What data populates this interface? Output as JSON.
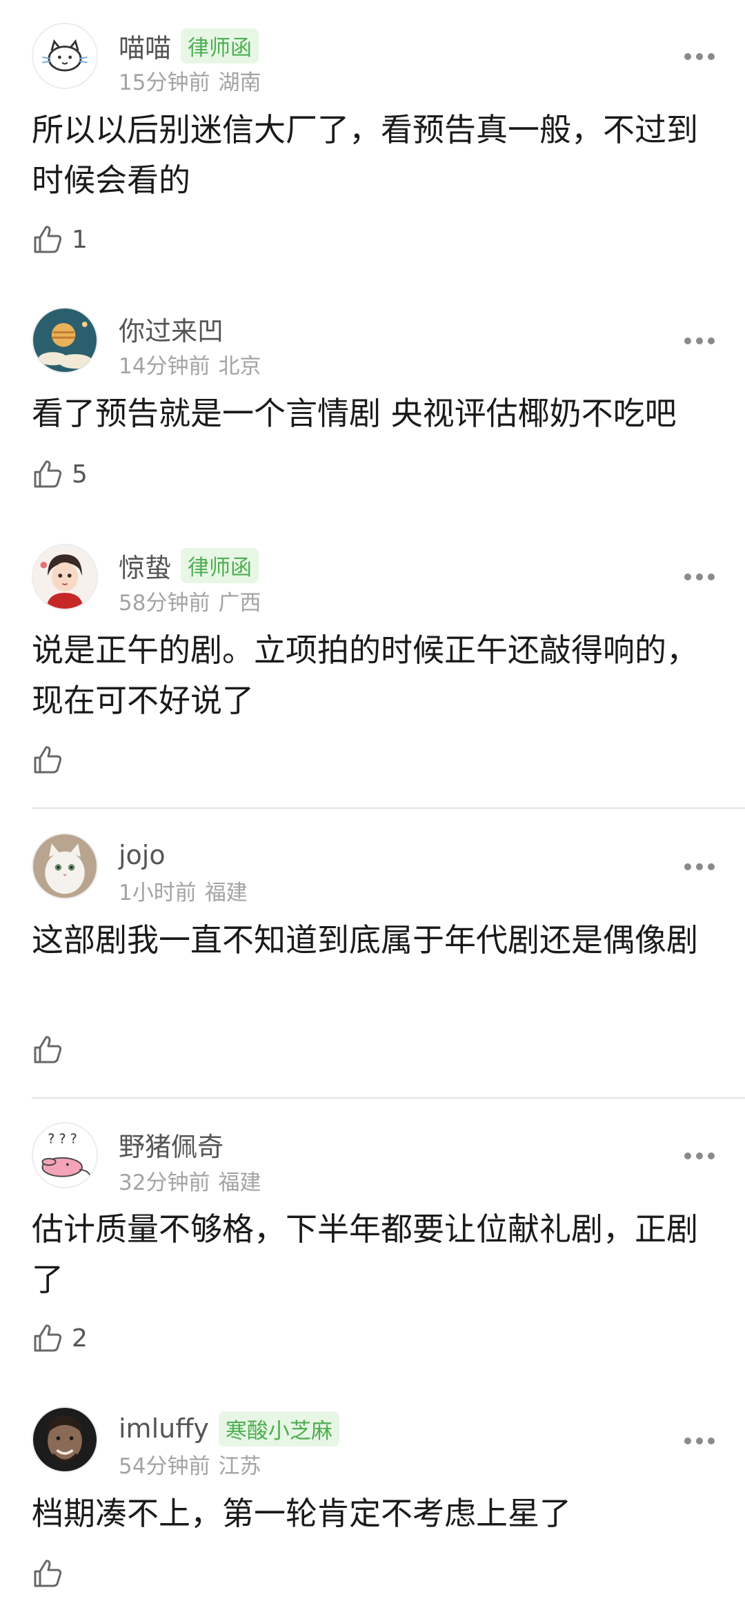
{
  "comments": [
    {
      "username": "喵喵",
      "badge": "律师函",
      "time": "15分钟前",
      "region": "湖南",
      "text": "所以以后别迷信大厂了，看预告真一般，不过到时候会看的",
      "likes": "1",
      "avatar_icon": "cat-doodle-avatar"
    },
    {
      "username": "你过来凹",
      "badge": "",
      "time": "14分钟前",
      "region": "北京",
      "text": "看了预告就是一个言情剧 央视评估椰奶不吃吧",
      "likes": "5",
      "avatar_icon": "planet-avatar"
    },
    {
      "username": "惊蛰",
      "badge": "律师函",
      "time": "58分钟前",
      "region": "广西",
      "text": "说是正午的剧。立项拍的时候正午还敲得响的，现在可不好说了",
      "likes": "",
      "avatar_icon": "cartoon-boy-avatar"
    },
    {
      "username": "jojo",
      "badge": "",
      "time": "1小时前",
      "region": "福建",
      "text": "这部剧我一直不知道到底属于年代剧还是偶像剧",
      "likes": "",
      "avatar_icon": "white-cat-avatar"
    },
    {
      "username": "野猪佩奇",
      "badge": "",
      "time": "32分钟前",
      "region": "福建",
      "text": "估计质量不够格，下半年都要让位献礼剧，正剧了",
      "likes": "2",
      "avatar_icon": "pink-rabbit-avatar"
    },
    {
      "username": "imluffy",
      "badge": "寒酸小芝麻",
      "time": "54分钟前",
      "region": "江苏",
      "text": "档期凑不上，第一轮肯定不考虑上星了",
      "likes": "",
      "avatar_icon": "man-portrait-avatar"
    }
  ],
  "colors": {
    "username": "#555555",
    "meta": "#a3a3a3",
    "badge_text": "#4caf50",
    "badge_bg": "#e8f6e6",
    "divider": "#e3e3e3"
  }
}
